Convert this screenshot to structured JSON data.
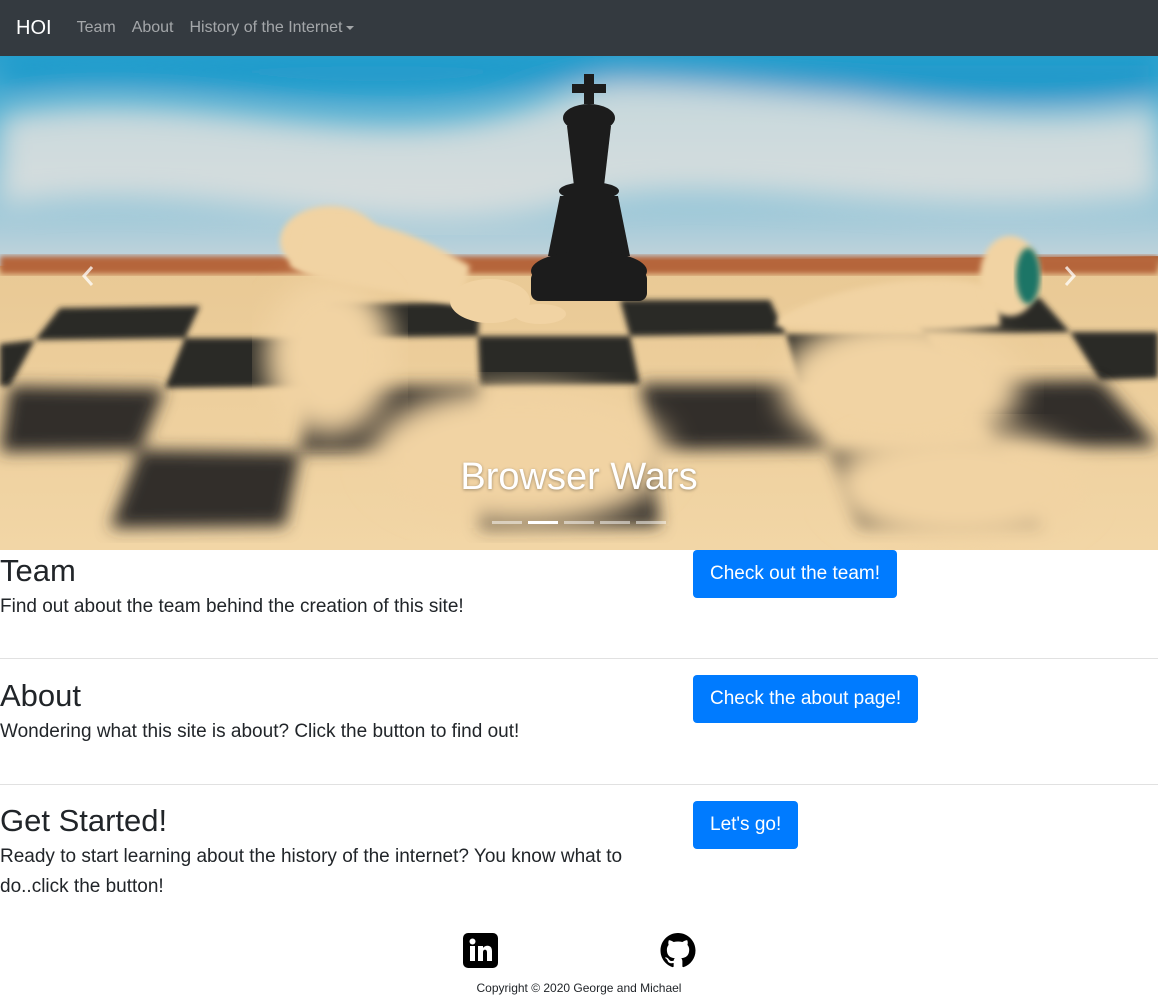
{
  "navbar": {
    "brand": "HOI",
    "links": [
      "Team",
      "About",
      "History of the Internet"
    ]
  },
  "carousel": {
    "caption": "Browser Wars",
    "slide_count": 5,
    "active_index": 1
  },
  "sections": [
    {
      "title": "Team",
      "text": "Find out about the team behind the creation of this site!",
      "button": "Check out the team!"
    },
    {
      "title": "About",
      "text": "Wondering what this site is about? Click the button to find out!",
      "button": "Check the about page!"
    },
    {
      "title": "Get Started!",
      "text": "Ready to start learning about the history of the internet? You know what to do..click the button!",
      "button": "Let's go!"
    }
  ],
  "footer": {
    "icons": [
      "linkedin-icon",
      "github-icon"
    ],
    "copyright": "Copyright © 2020 George and Michael"
  },
  "colors": {
    "navbar_bg": "#343a40",
    "primary_button": "#007bff"
  }
}
